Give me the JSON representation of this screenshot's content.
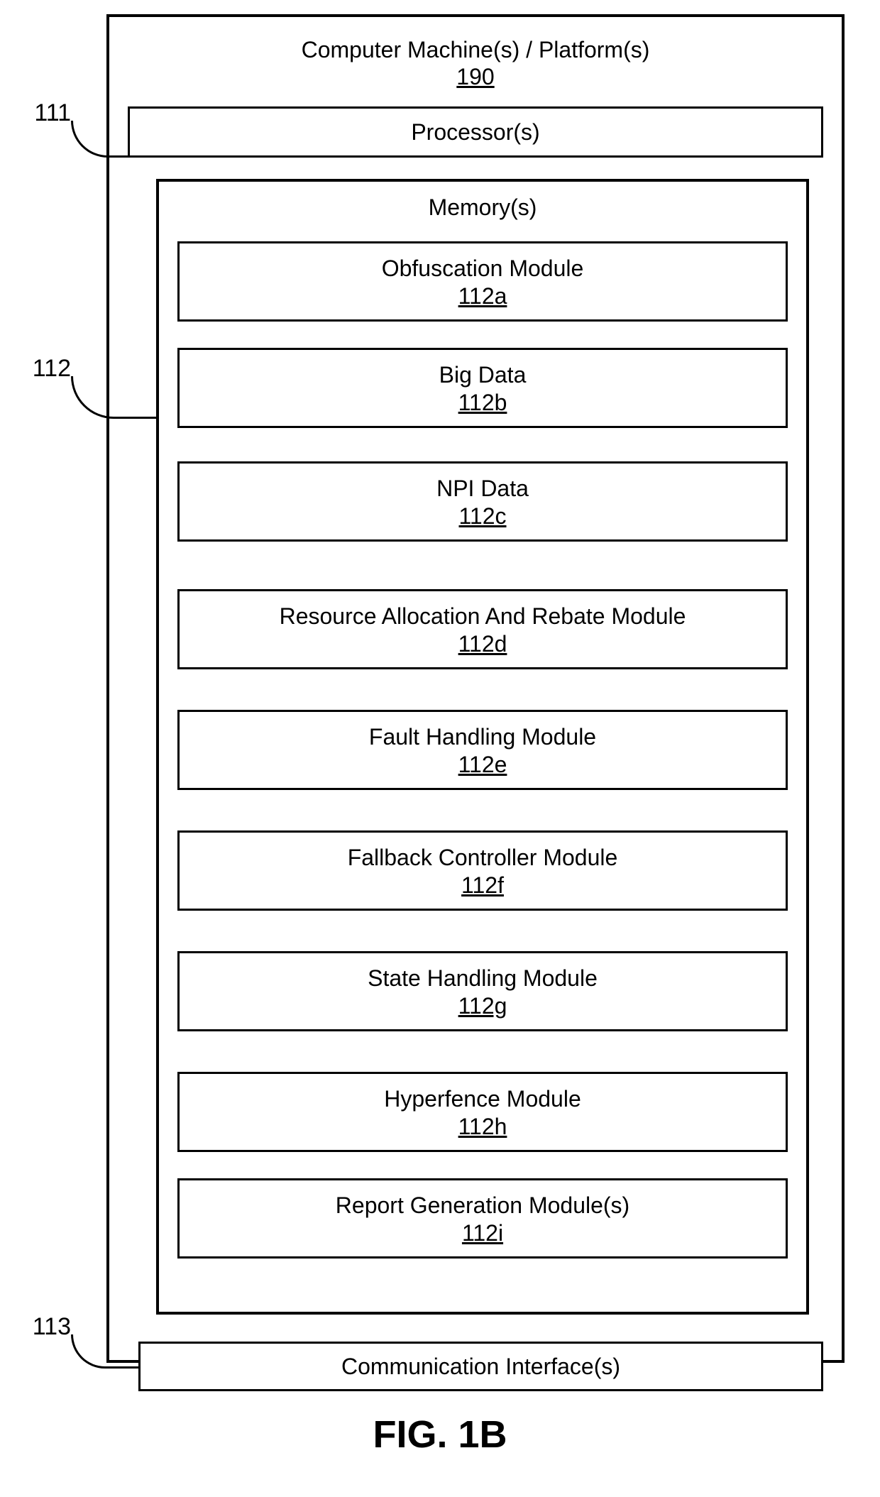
{
  "diagram": {
    "outer": {
      "title": "Computer Machine(s) / Platform(s)",
      "ref": "190"
    },
    "processor": {
      "label": "Processor(s)"
    },
    "memory": {
      "title": "Memory(s)"
    },
    "modules": [
      {
        "title": "Obfuscation Module",
        "ref": "112a"
      },
      {
        "title": "Big Data",
        "ref": "112b"
      },
      {
        "title": "NPI Data",
        "ref": "112c"
      },
      {
        "title": "Resource Allocation And Rebate Module",
        "ref": "112d"
      },
      {
        "title": "Fault Handling Module",
        "ref": "112e"
      },
      {
        "title": "Fallback Controller Module",
        "ref": "112f"
      },
      {
        "title": "State Handling Module",
        "ref": "112g"
      },
      {
        "title": "Hyperfence Module",
        "ref": "112h"
      },
      {
        "title": "Report Generation Module(s)",
        "ref": "112i"
      }
    ],
    "comm": {
      "label": "Communication Interface(s)"
    },
    "callouts": {
      "processor_ref": "111",
      "memory_ref": "112",
      "comm_ref": "113"
    },
    "figure_label": "FIG. 1B"
  }
}
